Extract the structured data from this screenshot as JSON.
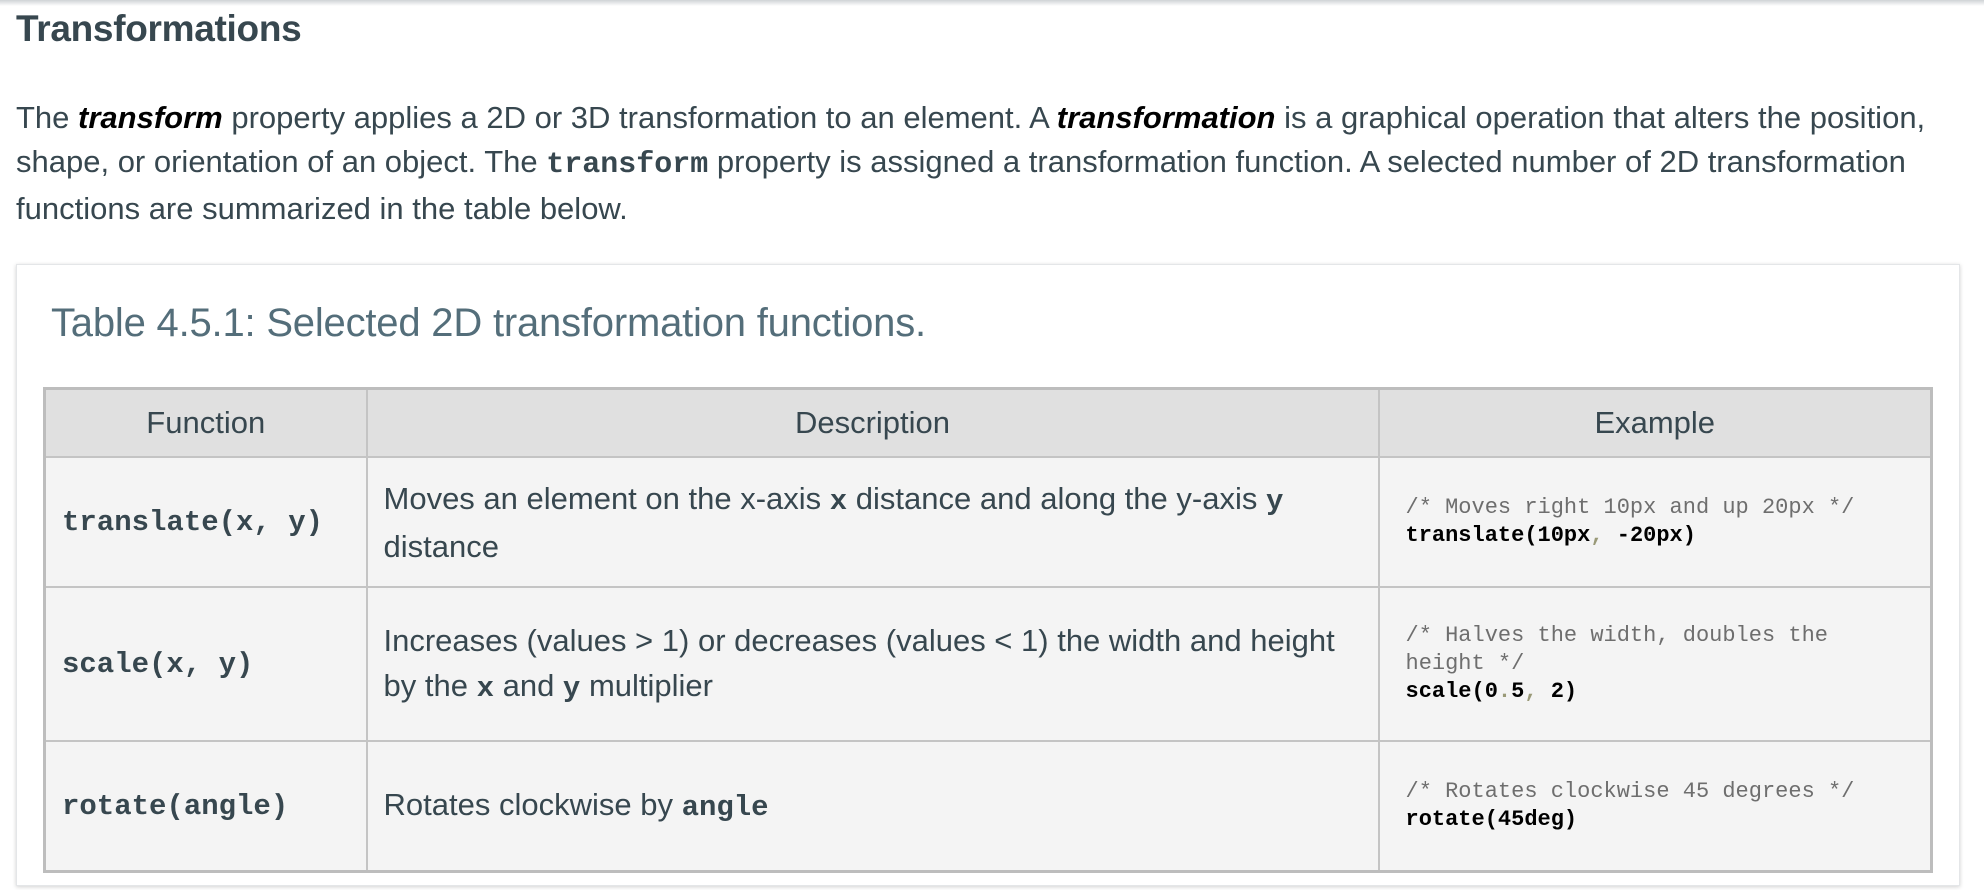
{
  "section": {
    "title": "Transformations"
  },
  "intro": {
    "t1": "The ",
    "em1": "transform",
    "t2": " property applies a 2D or 3D transformation to an element. A ",
    "em2": "transformation",
    "t3": " is a graphical operation that alters the position, shape, or orientation of an object. The ",
    "code1": "transform",
    "t4": " property is assigned a transformation function. A selected number of 2D transformation functions are summarized in the table below."
  },
  "table": {
    "caption": "Table 4.5.1: Selected 2D transformation functions.",
    "headers": [
      "Function",
      "Description",
      "Example"
    ],
    "rows": [
      {
        "function": "translate(x, y)",
        "desc": {
          "a": "Moves an element on the x-axis ",
          "code_a": "x",
          "b": " distance and along the y-axis ",
          "code_b": "y",
          "c": " distance"
        },
        "example": {
          "comment": "/* Moves right 10px and up 20px */",
          "code_a": "translate(10px",
          "punc": ",",
          "code_b": " -20px)"
        }
      },
      {
        "function": "scale(x, y)",
        "desc": {
          "a": "Increases (values > 1) or decreases (values < 1) the width and height by the ",
          "code_a": "x",
          "b": " and ",
          "code_b": "y",
          "c": " multiplier"
        },
        "example": {
          "comment": "/* Halves the width, doubles the height */",
          "code_a": "scale(0",
          "punc_a": ".",
          "code_b": "5",
          "punc_b": ",",
          "code_c": " 2)"
        }
      },
      {
        "function": "rotate(angle)",
        "desc": {
          "a": "Rotates clockwise by ",
          "code_a": "angle"
        },
        "example": {
          "comment": "/* Rotates clockwise 45 degrees */",
          "code_a": "rotate(45deg)"
        }
      }
    ]
  }
}
